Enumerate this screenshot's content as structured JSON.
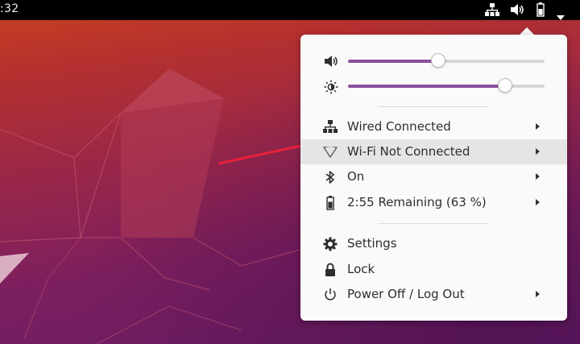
{
  "topbar": {
    "clock": ":32",
    "tray_icons": [
      "network-wired-icon",
      "volume-icon",
      "battery-icon",
      "dropdown-arrow-icon"
    ]
  },
  "system_menu": {
    "volume_slider": {
      "icon": "volume-icon",
      "level": 0.46
    },
    "brightness_slider": {
      "icon": "brightness-icon",
      "level": 0.8
    },
    "items": [
      {
        "label": "Wired Connected",
        "icon": "network-wired-icon",
        "has_submenu": true
      },
      {
        "label": "Wi-Fi Not Connected",
        "icon": "wifi-icon",
        "has_submenu": true,
        "highlighted": true
      },
      {
        "label": "On",
        "icon": "bluetooth-icon",
        "has_submenu": true
      },
      {
        "label": "2:55 Remaining (63 %)",
        "icon": "battery-icon",
        "has_submenu": true
      },
      {
        "label": "Settings",
        "icon": "gear-icon",
        "has_submenu": false
      },
      {
        "label": "Lock",
        "icon": "lock-icon",
        "has_submenu": false
      },
      {
        "label": "Power Off / Log Out",
        "icon": "power-icon",
        "has_submenu": true
      }
    ]
  },
  "annotation": {
    "arrow_color": "#e8203a"
  },
  "colors": {
    "slider_fill": "#8a4f9c",
    "highlight_row": "#e5e5e5",
    "menu_background": "#fafafa",
    "wallpaper_top": "#c9421f",
    "wallpaper_bottom": "#681d66"
  }
}
